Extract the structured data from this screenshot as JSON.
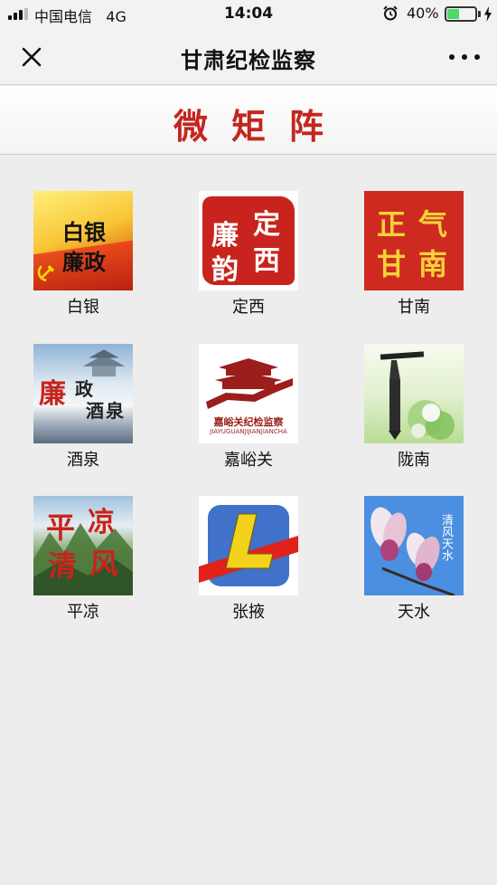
{
  "status_bar": {
    "carrier": "中国电信",
    "network": "4G",
    "time": "14:04",
    "battery": "40%",
    "battery_level": 0.4,
    "icons": [
      "signal-icon",
      "alarm-icon",
      "battery-icon",
      "charging-icon"
    ]
  },
  "nav": {
    "title": "甘肃纪检监察",
    "icons": [
      "close-icon",
      "more-icon"
    ]
  },
  "banner": {
    "title": "微矩阵"
  },
  "grid": {
    "items": [
      {
        "label": "白银",
        "thumb_text": [
          "白银",
          "廉政"
        ]
      },
      {
        "label": "定西",
        "thumb_text": [
          "廉",
          "韵",
          "定",
          "西"
        ]
      },
      {
        "label": "甘南",
        "thumb_text": [
          "正",
          "气",
          "甘",
          "南"
        ]
      },
      {
        "label": "酒泉",
        "thumb_text": [
          "廉",
          "政",
          "酒",
          "泉"
        ]
      },
      {
        "label": "嘉峪关",
        "thumb_text": [
          "嘉峪关纪检监察",
          "JIAYUGUANJIJIANJIANCHA"
        ]
      },
      {
        "label": "陇南",
        "thumb_text": []
      },
      {
        "label": "平凉",
        "thumb_text": [
          "平",
          "凉",
          "清",
          "风"
        ]
      },
      {
        "label": "张掖",
        "thumb_text": []
      },
      {
        "label": "天水",
        "thumb_text": [
          "清风天水"
        ]
      }
    ]
  },
  "colors": {
    "brand_red": "#c3261e",
    "battery_green": "#4cd964",
    "background": "#ededed"
  }
}
